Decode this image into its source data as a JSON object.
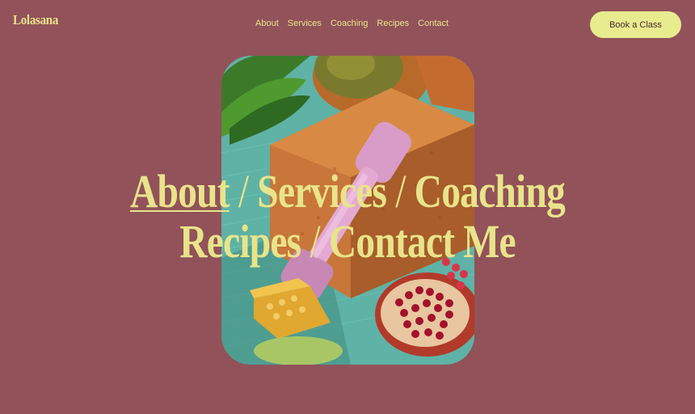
{
  "brand": {
    "logo_text": "Lolasana"
  },
  "nav": {
    "items": [
      {
        "label": "About"
      },
      {
        "label": "Services"
      },
      {
        "label": "Coaching"
      },
      {
        "label": "Recipes"
      },
      {
        "label": "Contact"
      }
    ]
  },
  "cta": {
    "label": "Book a Class"
  },
  "hero": {
    "image_icon": "wellness-still-life-photo",
    "headline": {
      "about": "About",
      "services": "Services",
      "coaching": "Coaching",
      "recipes": "Recipes",
      "contact": "Contact Me",
      "separator": "/"
    }
  },
  "colors": {
    "background": "#92525a",
    "accent_text": "#e8e48a",
    "button_bg": "#e8ec8f",
    "button_text": "#4a2a30"
  }
}
